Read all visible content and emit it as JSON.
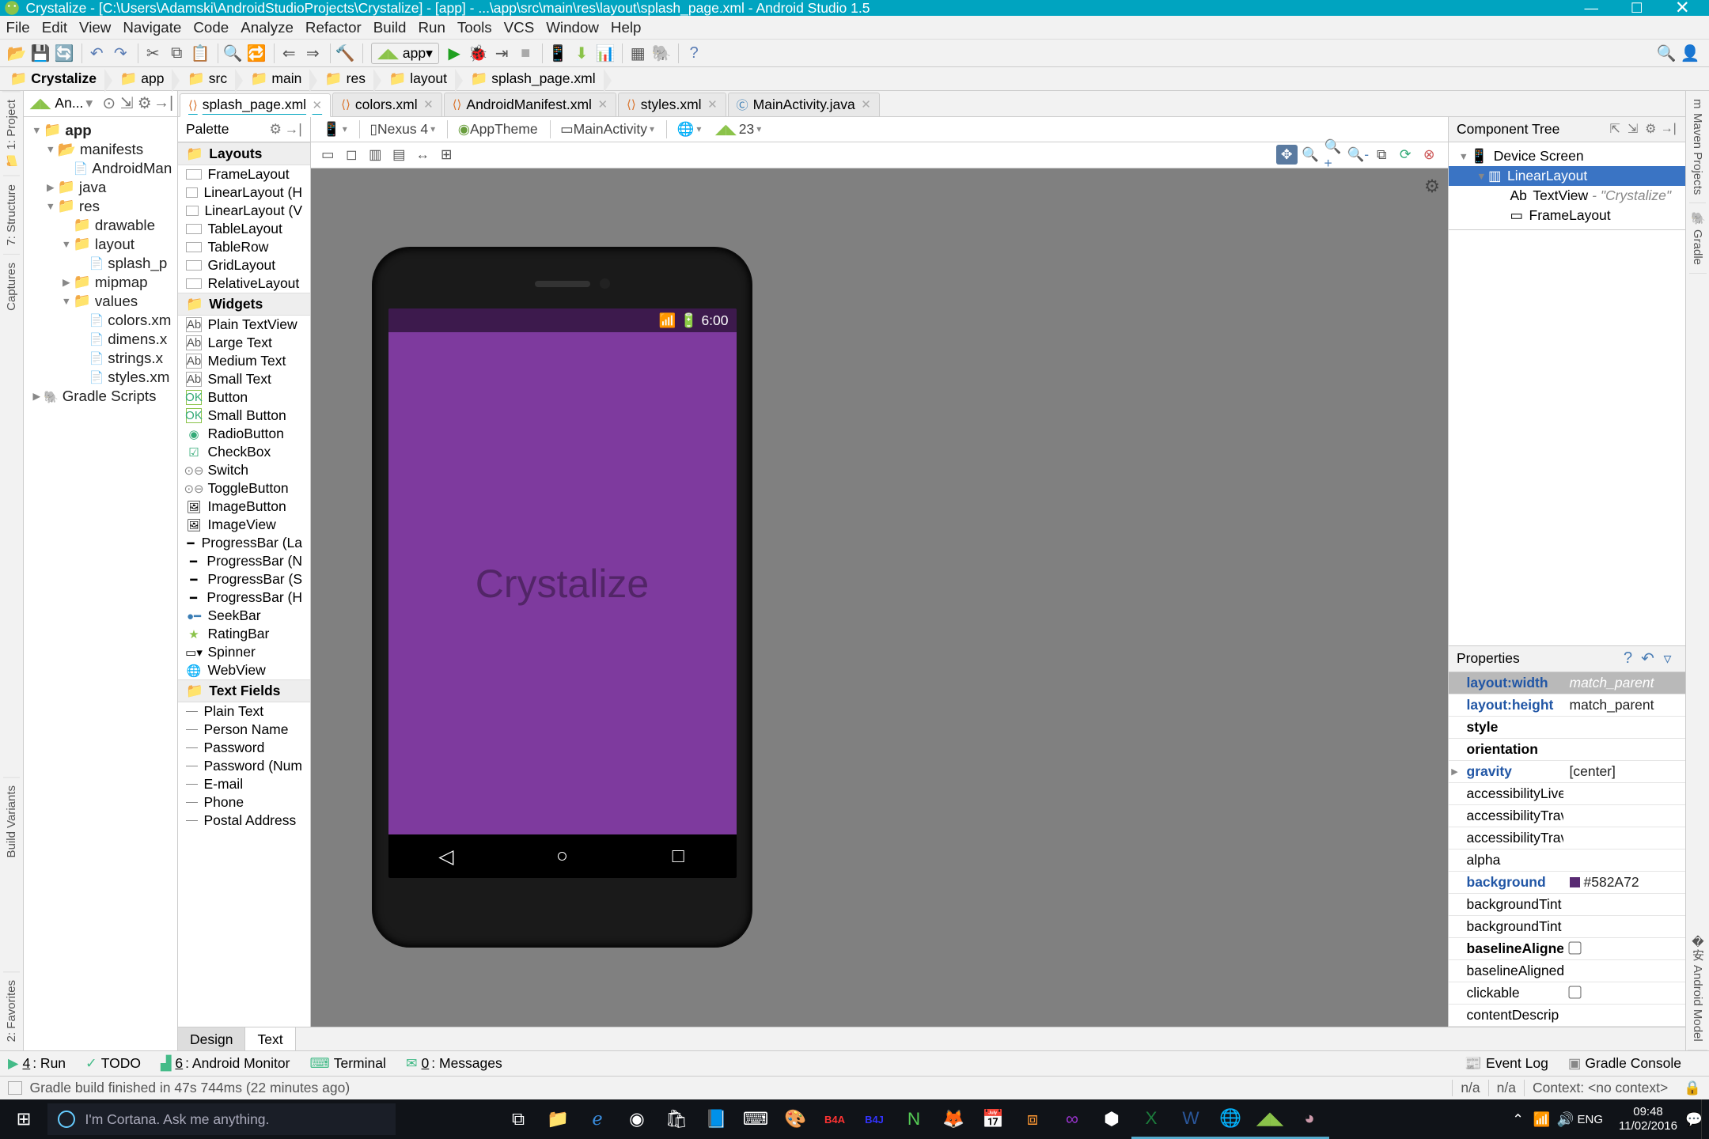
{
  "window": {
    "title": "Crystalize - [C:\\Users\\Adamski\\AndroidStudioProjects\\Crystalize] - [app] - ...\\app\\src\\main\\res\\layout\\splash_page.xml - Android Studio 1.5",
    "buttons": {
      "min": "—",
      "max": "☐",
      "close": "✕"
    }
  },
  "menu": [
    "File",
    "Edit",
    "View",
    "Navigate",
    "Code",
    "Analyze",
    "Refactor",
    "Build",
    "Run",
    "Tools",
    "VCS",
    "Window",
    "Help"
  ],
  "runconfig": "app",
  "breadcrumbs": [
    "Crystalize",
    "app",
    "src",
    "main",
    "res",
    "layout",
    "splash_page.xml"
  ],
  "projectpane": {
    "mode": "An...",
    "tree": [
      {
        "l": "app",
        "lvl": 0,
        "bold": true,
        "icon": "folder",
        "tw": "▼"
      },
      {
        "l": "manifests",
        "lvl": 1,
        "icon": "dir",
        "tw": "▼"
      },
      {
        "l": "AndroidMan",
        "lvl": 2,
        "icon": "file"
      },
      {
        "l": "java",
        "lvl": 1,
        "icon": "folder",
        "tw": "▶"
      },
      {
        "l": "res",
        "lvl": 1,
        "icon": "folder",
        "tw": "▼"
      },
      {
        "l": "drawable",
        "lvl": 2,
        "icon": "folder"
      },
      {
        "l": "layout",
        "lvl": 2,
        "icon": "folder",
        "tw": "▼"
      },
      {
        "l": "splash_p",
        "lvl": 3,
        "icon": "file"
      },
      {
        "l": "mipmap",
        "lvl": 2,
        "icon": "folder",
        "tw": "▶"
      },
      {
        "l": "values",
        "lvl": 2,
        "icon": "folder",
        "tw": "▼"
      },
      {
        "l": "colors.xm",
        "lvl": 3,
        "icon": "file"
      },
      {
        "l": "dimens.x",
        "lvl": 3,
        "icon": "file"
      },
      {
        "l": "strings.x",
        "lvl": 3,
        "icon": "file"
      },
      {
        "l": "styles.xm",
        "lvl": 3,
        "icon": "file"
      },
      {
        "l": "Gradle Scripts",
        "lvl": 0,
        "icon": "gradle",
        "tw": "▶"
      }
    ]
  },
  "editor_tabs": [
    {
      "name": "splash_page.xml",
      "active": true,
      "icon": "xml"
    },
    {
      "name": "colors.xml",
      "icon": "xml"
    },
    {
      "name": "AndroidManifest.xml",
      "icon": "xml"
    },
    {
      "name": "styles.xml",
      "icon": "xml"
    },
    {
      "name": "MainActivity.java",
      "icon": "java"
    }
  ],
  "palette": {
    "title": "Palette",
    "groups": [
      {
        "name": "Layouts",
        "items": [
          "FrameLayout",
          "LinearLayout (H",
          "LinearLayout (V",
          "TableLayout",
          "TableRow",
          "GridLayout",
          "RelativeLayout"
        ]
      },
      {
        "name": "Widgets",
        "items": [
          "Plain TextView",
          "Large Text",
          "Medium Text",
          "Small Text",
          "Button",
          "Small Button",
          "RadioButton",
          "CheckBox",
          "Switch",
          "ToggleButton",
          "ImageButton",
          "ImageView",
          "ProgressBar (La",
          "ProgressBar (N",
          "ProgressBar (S",
          "ProgressBar (H",
          "SeekBar",
          "RatingBar",
          "Spinner",
          "WebView"
        ]
      },
      {
        "name": "Text Fields",
        "items": [
          "Plain Text",
          "Person Name",
          "Password",
          "Password (Num",
          "E-mail",
          "Phone",
          "Postal Address"
        ]
      }
    ]
  },
  "design_toolbar": {
    "device": "Nexus 4",
    "theme": "AppTheme",
    "activity": "MainActivity",
    "api": "23"
  },
  "device_preview": {
    "time": "6:00",
    "app_text": "Crystalize"
  },
  "design_bottom_tabs": [
    "Design",
    "Text"
  ],
  "component_tree": {
    "title": "Component Tree",
    "nodes": [
      {
        "l": "Device Screen",
        "lvl": 0,
        "tw": "▼",
        "icon": "📱"
      },
      {
        "l": "LinearLayout",
        "lvl": 1,
        "tw": "▼",
        "icon": "▥",
        "selected": true
      },
      {
        "l": "TextView",
        "lvl": 2,
        "icon": "Ab",
        "hint": "- \"Crystalize\""
      },
      {
        "l": "FrameLayout",
        "lvl": 2,
        "icon": "▭"
      }
    ]
  },
  "properties": {
    "title": "Properties",
    "rows": [
      {
        "k": "layout:width",
        "v": "match_parent",
        "sel": true,
        "link": true
      },
      {
        "k": "layout:height",
        "v": "match_parent",
        "link": true
      },
      {
        "k": "style",
        "v": "",
        "bold": true
      },
      {
        "k": "orientation",
        "v": "",
        "bold": true
      },
      {
        "k": "gravity",
        "v": "[center]",
        "link": true,
        "tw": "▶"
      },
      {
        "k": "accessibilityLive",
        "v": ""
      },
      {
        "k": "accessibilityTrav",
        "v": ""
      },
      {
        "k": "accessibilityTrav",
        "v": ""
      },
      {
        "k": "alpha",
        "v": ""
      },
      {
        "k": "background",
        "v": "#582A72",
        "link": true,
        "swatch": true
      },
      {
        "k": "backgroundTint",
        "v": ""
      },
      {
        "k": "backgroundTint",
        "v": ""
      },
      {
        "k": "baselineAligne",
        "v": "",
        "bold": true,
        "checkbox": true
      },
      {
        "k": "baselineAligned",
        "v": ""
      },
      {
        "k": "clickable",
        "v": "",
        "checkbox": true
      },
      {
        "k": "contentDescrip",
        "v": ""
      }
    ]
  },
  "left_tabs": [
    {
      "l": "1: Project",
      "num": "1"
    },
    {
      "l": "7: Structure",
      "num": "7"
    },
    {
      "l": "Captures"
    },
    {
      "l": "Build Variants"
    },
    {
      "l": "2: Favorites",
      "num": "2"
    }
  ],
  "right_tabs": [
    {
      "l": "Maven Projects",
      "ic": "m"
    },
    {
      "l": "Gradle",
      "ic": "🐘"
    },
    {
      "l": "Android Model",
      "ic": "�安"
    }
  ],
  "bottom_tabs": {
    "left": [
      {
        "num": "4",
        "l": "Run",
        "ic": "▶"
      },
      {
        "l": "TODO",
        "ic": "✓"
      },
      {
        "num": "6",
        "l": "Android Monitor",
        "ic": "▟"
      },
      {
        "l": "Terminal",
        "ic": "⌨"
      },
      {
        "num": "0",
        "l": "Messages",
        "ic": "✉"
      }
    ],
    "right": [
      {
        "l": "Event Log",
        "ic": "📰"
      },
      {
        "l": "Gradle Console",
        "ic": "▣"
      }
    ]
  },
  "statusline": {
    "text": "Gradle build finished in 47s 744ms (22 minutes ago)",
    "cells": [
      "n/a",
      "n/a",
      "Context: <no context>"
    ]
  },
  "taskbar": {
    "cortana": "I'm Cortana. Ask me anything.",
    "tray_lang": "ENG",
    "time": "09:48",
    "date": "11/02/2016"
  }
}
